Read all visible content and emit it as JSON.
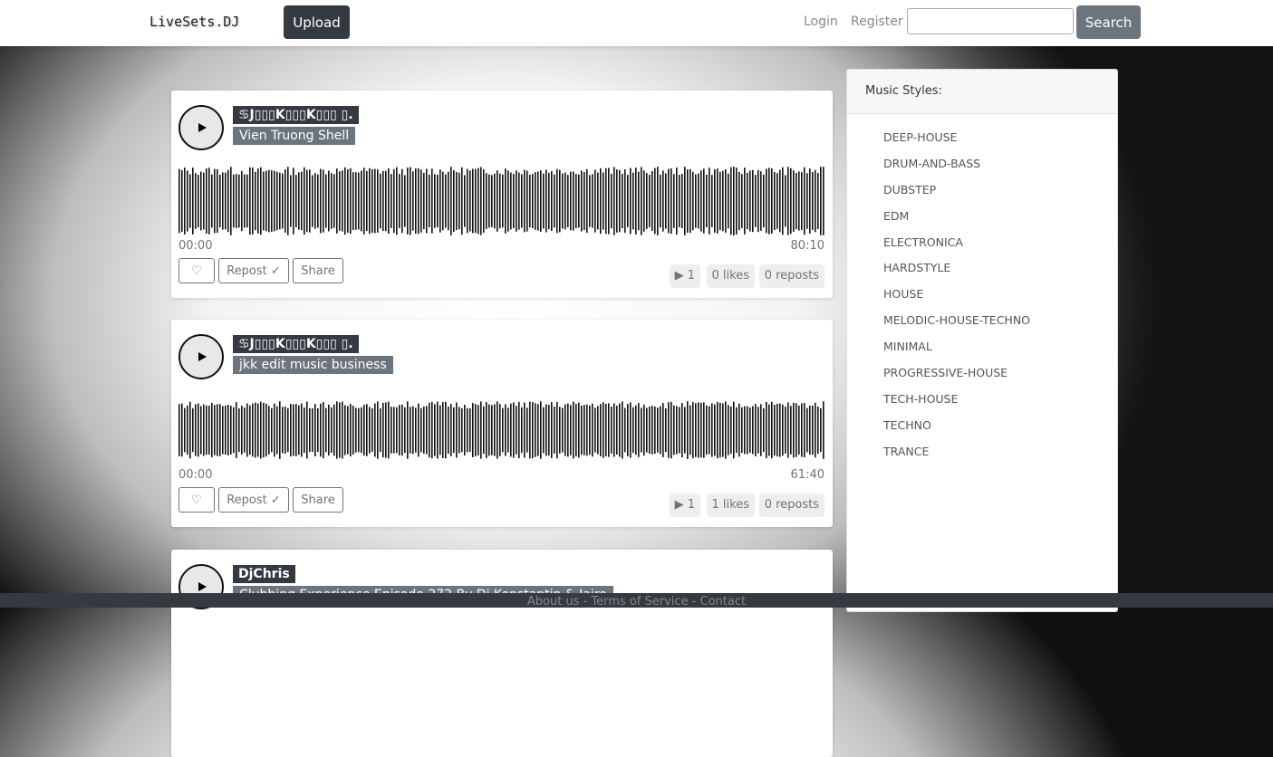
{
  "nav": {
    "brand": "LiveSets.DJ",
    "upload": "Upload",
    "login": "Login",
    "register": "Register",
    "search_value": "",
    "search_button": "Search"
  },
  "sets": [
    {
      "title": "♋J▯▯▯K▯▯▯K▯▯▯ ▯.",
      "artist": "Vien Truong Shell",
      "start": "00:00",
      "duration": "80:10",
      "plays": "▶ 1",
      "likes": "0 likes",
      "reposts": "0 reposts"
    },
    {
      "title": "♋J▯▯▯K▯▯▯K▯▯▯ ▯.",
      "artist": "jkk edit music business",
      "start": "00:00",
      "duration": "61:40",
      "plays": "▶ 1",
      "likes": "1 likes",
      "reposts": "0 reposts"
    },
    {
      "title": "DjChris",
      "artist": "Clubbing Experience Episode 272 By Dj Konstantin & Jairo"
    }
  ],
  "buttons": {
    "like": "♡",
    "repost": "Repost ✓",
    "share": "Share"
  },
  "sidebar": {
    "header": "Music Styles:",
    "styles": [
      "DEEP-HOUSE",
      "DRUM-AND-BASS",
      "DUBSTEP",
      "EDM",
      "ELECTRONICA",
      "HARDSTYLE",
      "HOUSE",
      "MELODIC-HOUSE-TECHNO",
      "MINIMAL",
      "PROGRESSIVE-HOUSE",
      "TECH-HOUSE",
      "TECHNO",
      "TRANCE"
    ]
  },
  "footer": {
    "about": "About us",
    "terms": "Terms of Service",
    "contact": "Contact",
    "sep": " - "
  },
  "colors": {
    "dark": "#343a40",
    "secondary": "#6c757d"
  }
}
